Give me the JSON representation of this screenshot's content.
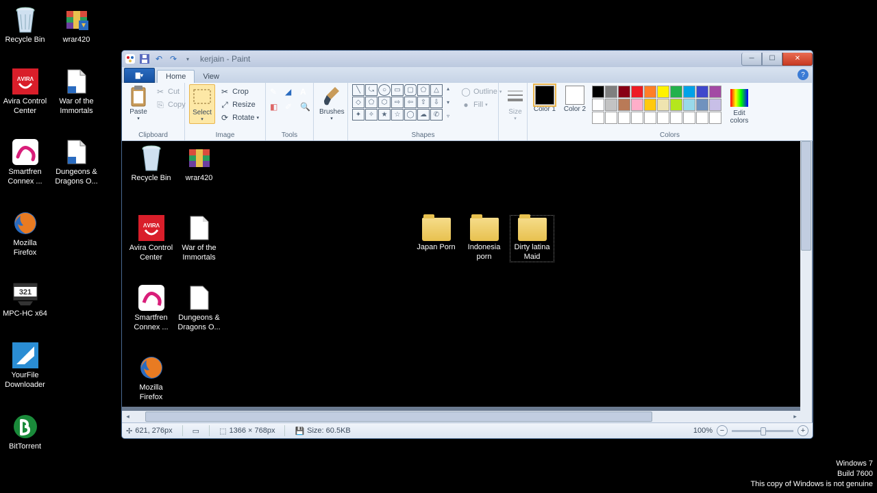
{
  "desktop_icons": {
    "recycle": "Recycle Bin",
    "wrar": "wrar420",
    "avira": "Avira Control Center",
    "war": "War of the Immortals",
    "smartfren": "Smartfren Connex ...",
    "dnd": "Dungeons & Dragons O...",
    "firefox": "Mozilla Firefox",
    "mpc": "MPC-HC x64",
    "yourfile": "YourFile Downloader",
    "bittorrent": "BitTorrent"
  },
  "watermark": {
    "l1": "Windows 7",
    "l2": "Build 7600",
    "l3": "This copy of Windows is not genuine"
  },
  "window": {
    "title": "kerjain - Paint",
    "tabs": {
      "home": "Home",
      "view": "View"
    },
    "clipboard": {
      "paste": "Paste",
      "cut": "Cut",
      "copy": "Copy",
      "label": "Clipboard"
    },
    "image": {
      "select": "Select",
      "crop": "Crop",
      "resize": "Resize",
      "rotate": "Rotate",
      "label": "Image"
    },
    "tools": {
      "label": "Tools"
    },
    "brushes": {
      "label": "Brushes",
      "btn": "Brushes"
    },
    "shapes": {
      "label": "Shapes",
      "outline": "Outline",
      "fill": "Fill"
    },
    "size": {
      "btn": "Size"
    },
    "colors": {
      "c1": "Color 1",
      "c2": "Color 2",
      "edit": "Edit colors",
      "label": "Colors",
      "row1": [
        "#000000",
        "#7f7f7f",
        "#880015",
        "#ed1c24",
        "#ff7f27",
        "#fff200",
        "#22b14c",
        "#00a2e8",
        "#3f48cc",
        "#a349a4"
      ],
      "row2": [
        "#ffffff",
        "#c3c3c3",
        "#b97a57",
        "#ffaec9",
        "#ffc90e",
        "#efe4b0",
        "#b5e61d",
        "#99d9ea",
        "#7092be",
        "#c8bfe7"
      ]
    },
    "canvas_icons": {
      "recycle": "Recycle Bin",
      "wrar": "wrar420",
      "avira": "Avira Control Center",
      "war": "War of the Immortals",
      "smartfren": "Smartfren Connex ...",
      "dnd": "Dungeons & Dragons O...",
      "firefox": "Mozilla Firefox",
      "japan": "Japan Porn",
      "indonesia": "Indonesia porn",
      "dirty": "Dirty latina Maid"
    },
    "status": {
      "pos": "621, 276px",
      "dim": "1366 × 768px",
      "size": "Size: 60.5KB",
      "zoom": "100%"
    }
  }
}
